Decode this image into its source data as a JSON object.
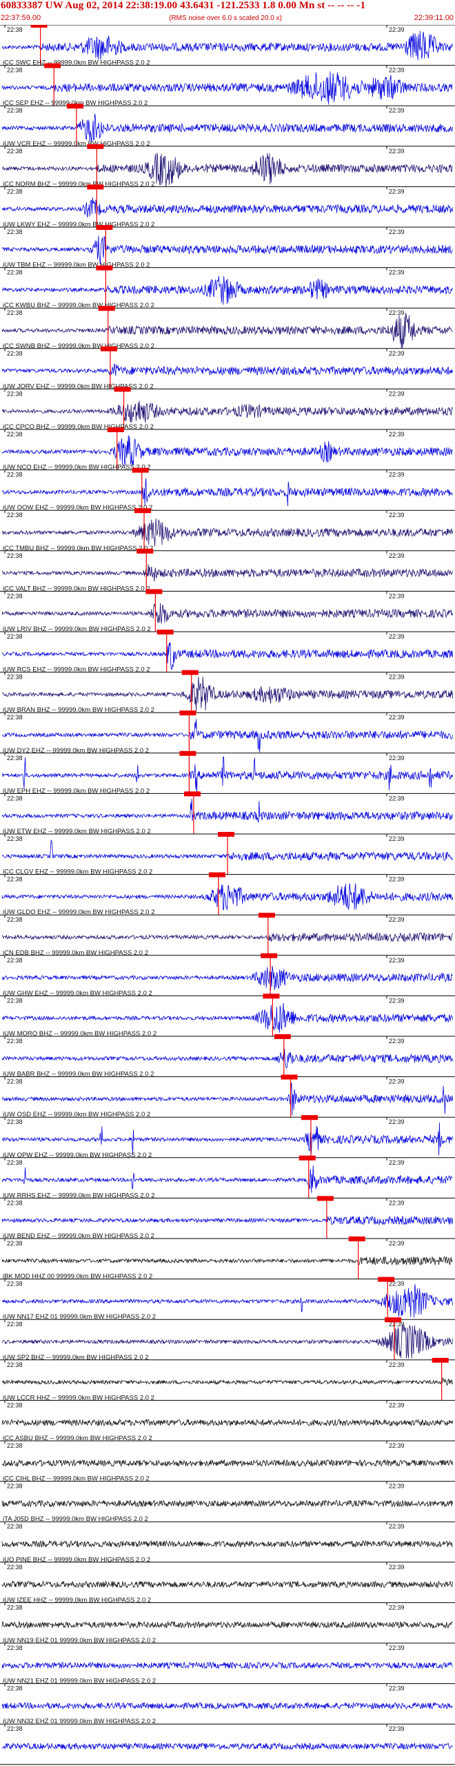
{
  "header": {
    "title": "60833387 UW Aug 02, 2014 22:38:19.00   43.6431 -121.2533  1.8 0.00 Mn st -- -- --  -1",
    "start_time": "22:37:59.00",
    "end_time": "22:39:11.00",
    "subtitle": "(RMS noise over 6.0 s scaled 20.0 x)"
  },
  "colors": {
    "trace_blue": "#0000dd",
    "trace_navy": "#1a1070",
    "trace_black": "#111111",
    "pick_red": "#ee0000",
    "label_text": "#111111"
  },
  "chart_data": {
    "type": "seismogram_record_section",
    "time_window": {
      "start": "22:37:59.00",
      "end": "22:39:11.00"
    },
    "tick_labels": [
      "22:38",
      "22:39"
    ],
    "traces": [
      {
        "label": "",
        "color": "blue",
        "pick": 0.085,
        "bursts": [
          [
            0.22,
            0.05,
            0.7
          ],
          [
            0.93,
            0.04,
            0.9
          ]
        ],
        "spikes": []
      },
      {
        "label": "iCC SWC EHZ -- 99999.0km BW  HIGHPASS  2.0  2",
        "color": "blue",
        "pick": 0.115,
        "bursts": [
          [
            0.72,
            0.08,
            0.9
          ],
          [
            0.85,
            0.05,
            0.7
          ]
        ],
        "spikes": []
      },
      {
        "label": "iCC SEP EHZ -- 99999.0km BW  HIGHPASS  2.0  2",
        "color": "blue",
        "pick": 0.165,
        "bursts": [
          [
            0.2,
            0.03,
            0.8
          ]
        ],
        "spikes": []
      },
      {
        "label": "iUW VCR EHZ -- 99999.0km BW  HIGHPASS  2.0  2",
        "color": "navy",
        "pick": 0.21,
        "bursts": [
          [
            0.36,
            0.04,
            1.0
          ],
          [
            0.59,
            0.035,
            0.9
          ]
        ],
        "spikes": []
      },
      {
        "label": "iCC NORM BHZ -- 99999.0km BW  HIGHPASS  2.0  2",
        "color": "blue",
        "pick": 0.21,
        "bursts": [
          [
            0.2,
            0.02,
            0.6
          ]
        ],
        "spikes": []
      },
      {
        "label": "iUW LKWY EHZ -- 99999.0km BW  HIGHPASS  2.0  2",
        "color": "blue",
        "pick": 0.23,
        "bursts": [
          [
            0.22,
            0.02,
            0.8
          ]
        ],
        "spikes": []
      },
      {
        "label": "iUW TBM EHZ -- 99999.0km BW  HIGHPASS  2.0  2",
        "color": "blue",
        "pick": 0.23,
        "bursts": [
          [
            0.49,
            0.04,
            0.8
          ],
          [
            0.7,
            0.03,
            0.6
          ]
        ],
        "spikes": []
      },
      {
        "label": "iCC KWBU BHZ -- 99999.0km BW  HIGHPASS  2.0  2",
        "color": "navy",
        "pick": 0.235,
        "bursts": [
          [
            0.89,
            0.03,
            1.0
          ]
        ],
        "spikes": []
      },
      {
        "label": "iCC SWNB BHZ -- 99999.0km BW  HIGHPASS  2.0  2",
        "color": "blue",
        "pick": 0.24,
        "bursts": [
          [
            0.25,
            0.015,
            0.4
          ]
        ],
        "spikes": []
      },
      {
        "label": "iUW JORV EHZ -- 99999.0km BW  HIGHPASS  2.0  2",
        "color": "navy",
        "pick": 0.27,
        "bursts": [
          [
            0.3,
            0.05,
            0.7
          ],
          [
            0.55,
            0.05,
            0.4
          ]
        ],
        "spikes": []
      },
      {
        "label": "iCC CPCO BHZ -- 99999.0km BW  HIGHPASS  2.0  2",
        "color": "blue",
        "pick": 0.255,
        "bursts": [
          [
            0.28,
            0.03,
            0.9
          ],
          [
            0.72,
            0.02,
            0.6
          ]
        ],
        "spikes": []
      },
      {
        "label": "iUW NCO EHZ -- 99999.0km BW  HIGHPASS  2.0  2",
        "color": "blue",
        "pick": 0.31,
        "bursts": [
          [
            0.32,
            0.008,
            1.0
          ]
        ],
        "spikes": [
          0.635
        ]
      },
      {
        "label": "iUW OOW EHZ -- 99999.0km BW  HIGHPASS  2.0  2",
        "color": "navy",
        "pick": 0.315,
        "bursts": [
          [
            0.34,
            0.04,
            0.8
          ]
        ],
        "spikes": []
      },
      {
        "label": "iCC TMBU BHZ -- 99999.0km BW  HIGHPASS  2.0  2",
        "color": "navy",
        "pick": 0.32,
        "bursts": [
          [
            0.33,
            0.015,
            0.6
          ]
        ],
        "spikes": []
      },
      {
        "label": "iCC VALT BHZ -- 99999.0km BW  HIGHPASS  2.0  2",
        "color": "navy",
        "pick": 0.34,
        "bursts": [
          [
            0.35,
            0.02,
            0.8
          ]
        ],
        "spikes": []
      },
      {
        "label": "iUW LRIV BHZ -- 99999.0km BW  HIGHPASS  2.0  2",
        "color": "blue",
        "pick": 0.365,
        "bursts": [
          [
            0.375,
            0.01,
            1.0
          ]
        ],
        "spikes": []
      },
      {
        "label": "iUW RCS EHZ -- 99999.0km BW  HIGHPASS  2.0  2",
        "color": "navy",
        "pick": 0.42,
        "bursts": [
          [
            0.44,
            0.03,
            1.0
          ],
          [
            0.6,
            0.06,
            0.5
          ]
        ],
        "spikes": []
      },
      {
        "label": "iUW BRAN BHZ -- 99999.0km BW  HIGHPASS  2.0  2",
        "color": "blue",
        "pick": 0.415,
        "bursts": [],
        "spikes": [
          0.43,
          0.57
        ]
      },
      {
        "label": "iUW DY2 EHZ -- 99999.0km BW  HIGHPASS  2.0  2",
        "color": "blue",
        "pick": 0.415,
        "bursts": [],
        "spikes": [
          0.05,
          0.3,
          0.43,
          0.49,
          0.56,
          0.86,
          0.95
        ]
      },
      {
        "label": "iUW EPH EHZ -- 99999.0km BW  HIGHPASS  2.0  2",
        "color": "blue",
        "pick": 0.425,
        "bursts": [],
        "spikes": [
          0.42,
          0.57
        ]
      },
      {
        "label": "iUW ETW EHZ -- 99999.0km BW  HIGHPASS  2.0  2",
        "color": "blue",
        "pick": 0.5,
        "bursts": [],
        "spikes": [
          0.11
        ]
      },
      {
        "label": "iCC CLGV EHZ -- 99999.0km BW  HIGHPASS  2.0  2",
        "color": "blue",
        "pick": 0.48,
        "bursts": [
          [
            0.5,
            0.04,
            0.8
          ],
          [
            0.77,
            0.05,
            0.8
          ]
        ],
        "spikes": []
      },
      {
        "label": "iUW GLDO EHZ -- 99999.0km BW  HIGHPASS  2.0  2",
        "color": "navy",
        "pick": 0.59,
        "bursts": [],
        "spikes": []
      },
      {
        "label": "iCN EDB BHZ -- 99999.0km BW  HIGHPASS  2.0  2",
        "color": "blue",
        "pick": 0.595,
        "bursts": [
          [
            0.6,
            0.04,
            0.7
          ]
        ],
        "spikes": []
      },
      {
        "label": "iUW GHW EHZ -- 99999.0km BW  HIGHPASS  2.0  2",
        "color": "blue",
        "pick": 0.6,
        "bursts": [
          [
            0.61,
            0.04,
            0.9
          ]
        ],
        "spikes": []
      },
      {
        "label": "iUW MORO BHZ -- 99999.0km BW  HIGHPASS  2.0  2",
        "color": "blue",
        "pick": 0.625,
        "bursts": [
          [
            0.63,
            0.02,
            0.6
          ]
        ],
        "spikes": []
      },
      {
        "label": "iUW BABR BHZ -- 99999.0km BW  HIGHPASS  2.0  2",
        "color": "blue",
        "pick": 0.64,
        "bursts": [
          [
            0.645,
            0.008,
            1.0
          ]
        ],
        "spikes": [
          0.98
        ]
      },
      {
        "label": "iUW OSD EHZ -- 99999.0km BW  HIGHPASS  2.0  2",
        "color": "blue",
        "pick": 0.685,
        "bursts": [
          [
            0.69,
            0.015,
            1.0
          ]
        ],
        "spikes": [
          0.22,
          0.29,
          0.97
        ]
      },
      {
        "label": "iUW OPW EHZ -- 99999.0km BW  HIGHPASS  2.0  2",
        "color": "blue",
        "pick": 0.68,
        "bursts": [
          [
            0.69,
            0.01,
            0.9
          ]
        ],
        "spikes": [
          0.05,
          0.29
        ]
      },
      {
        "label": "iUW RRHS EHZ -- 99999.0km BW  HIGHPASS  2.0  2",
        "color": "blue",
        "pick": 0.72,
        "bursts": [],
        "spikes": []
      },
      {
        "label": "iUW BEND EHZ -- 99999.0km BW  HIGHPASS  2.0  2",
        "color": "black",
        "pick": 0.79,
        "bursts": [],
        "spikes": []
      },
      {
        "label": "iBK MOD HHZ 00 99999.0km BW  HIGHPASS  2.0  2",
        "color": "blue",
        "pick": 0.855,
        "bursts": [
          [
            0.9,
            0.05,
            1.0
          ]
        ],
        "spikes": [
          0.665
        ]
      },
      {
        "label": "iUW NN17 EHZ 01 99999.0km BW  HIGHPASS  2.0  2",
        "color": "navy",
        "pick": 0.87,
        "bursts": [
          [
            0.9,
            0.05,
            1.0
          ]
        ],
        "spikes": []
      },
      {
        "label": "iUW SP2 BHZ -- 99999.0km BW  HIGHPASS  2.0  2",
        "color": "black",
        "pick": 0.975,
        "bursts": [],
        "spikes": []
      },
      {
        "label": "iUW LCCR HHZ -- 99999.0km BW  HIGHPASS  2.0  2",
        "color": "black",
        "pick": null,
        "bursts": [],
        "spikes": []
      },
      {
        "label": "iCC ASBU BHZ -- 99999.0km BW  HIGHPASS  2.0  2",
        "color": "black",
        "pick": null,
        "bursts": [],
        "spikes": []
      },
      {
        "label": "iCC CIHL BHZ -- 99999.0km BW  HIGHPASS  2.0  2",
        "color": "black",
        "pick": null,
        "bursts": [],
        "spikes": []
      },
      {
        "label": "iTA J05D BHZ -- 99999.0km BW  HIGHPASS  2.0  2",
        "color": "black",
        "pick": null,
        "bursts": [],
        "spikes": []
      },
      {
        "label": "iUO PINE BHZ -- 99999.0km BW  HIGHPASS  2.0  2",
        "color": "black",
        "pick": null,
        "bursts": [],
        "spikes": []
      },
      {
        "label": "iUW IZEE HHZ -- 99999.0km BW  HIGHPASS  2.0  2",
        "color": "black",
        "pick": null,
        "bursts": [],
        "spikes": []
      },
      {
        "label": "iUW NN19 EHZ 01 99999.0km BW  HIGHPASS  2.0  2",
        "color": "blue",
        "pick": null,
        "bursts": [],
        "spikes": []
      },
      {
        "label": "iUW NN21 EHZ 01 99999.0km BW  HIGHPASS  2.0  2",
        "color": "blue",
        "pick": null,
        "bursts": [],
        "spikes": []
      },
      {
        "label": "iUW NN32 EHZ 01 99999.0km BW  HIGHPASS  2.0  2",
        "color": "blue",
        "pick": null,
        "bursts": [],
        "spikes": []
      }
    ]
  }
}
